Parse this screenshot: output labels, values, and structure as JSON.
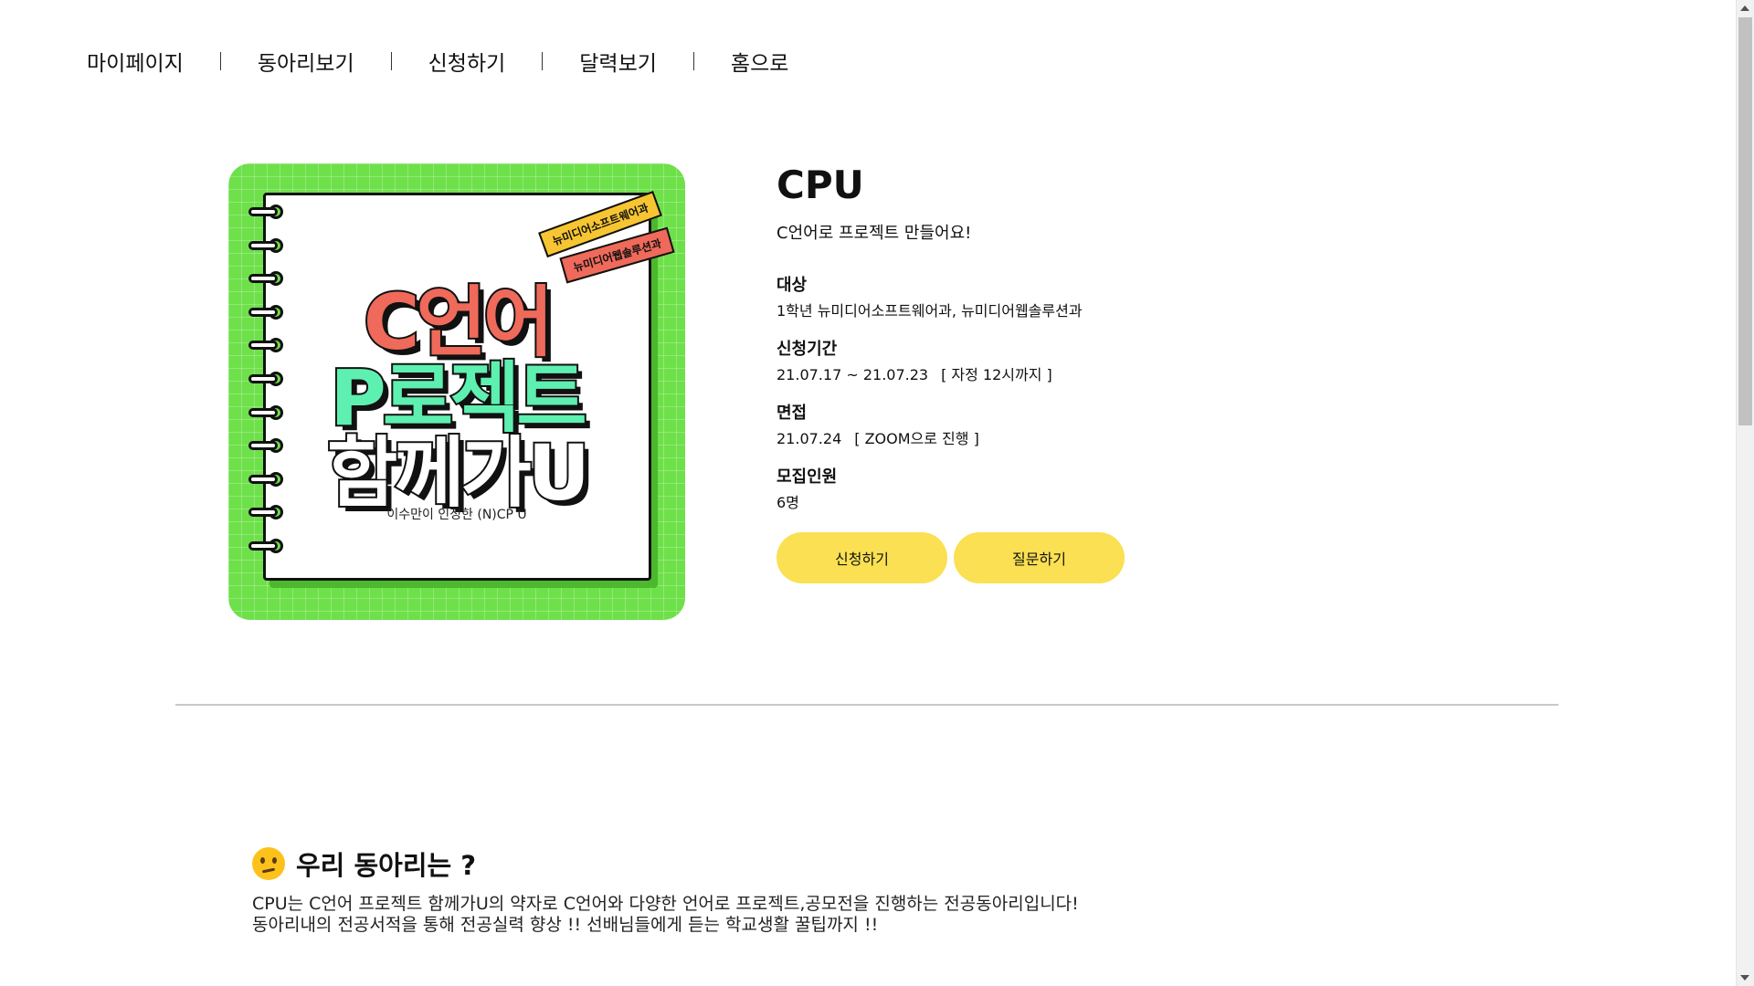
{
  "nav": {
    "items": [
      {
        "label": "마이페이지"
      },
      {
        "label": "동아리보기"
      },
      {
        "label": "신청하기"
      },
      {
        "label": "달력보기"
      },
      {
        "label": "홈으로"
      }
    ],
    "separator": "|"
  },
  "poster": {
    "tag1": "뉴미디어소프트웨어과",
    "tag2": "뉴미디어웹솔루션과",
    "line1": "C언어",
    "line2": "P로젝트",
    "line3": "함께가U",
    "caption": "이수만이 인정한 (N)CP U",
    "colors": {
      "background": "#6ee04a",
      "line1": "#ef6a5a",
      "line2": "#5ef0b0",
      "tag1": "#f7c531",
      "tag2": "#ef6a5a"
    }
  },
  "club": {
    "name": "CPU",
    "description": "C언어로 프로젝트 만들어요!",
    "fields": {
      "target_label": "대상",
      "target_value": "1학년 뉴미디어소프트웨어과, 뉴미디어웹솔루션과",
      "period_label": "신청기간",
      "period_value": "21.07.17 ~ 21.07.23",
      "period_note": "[ 자정 12시까지 ]",
      "interview_label": "면접",
      "interview_value": "21.07.24",
      "interview_note": "[ ZOOM으로 진행 ]",
      "capacity_label": "모집인원",
      "capacity_value": "6명"
    },
    "apply_button": "신청하기",
    "question_button": "질문하기",
    "button_color": "#fae052"
  },
  "about": {
    "icon": "thinking-face-icon",
    "title": "우리 동아리는 ?",
    "line1": "CPU는 C언어 프로젝트 함께가U의 약자로 C언어와 다양한 언어로 프로젝트,공모전을 진행하는 전공동아리입니다!",
    "line2": "동아리내의 전공서적을 통해 전공실력 향상 !! 선배님들에게 듣는 학교생활 꿀팁까지 !!"
  }
}
